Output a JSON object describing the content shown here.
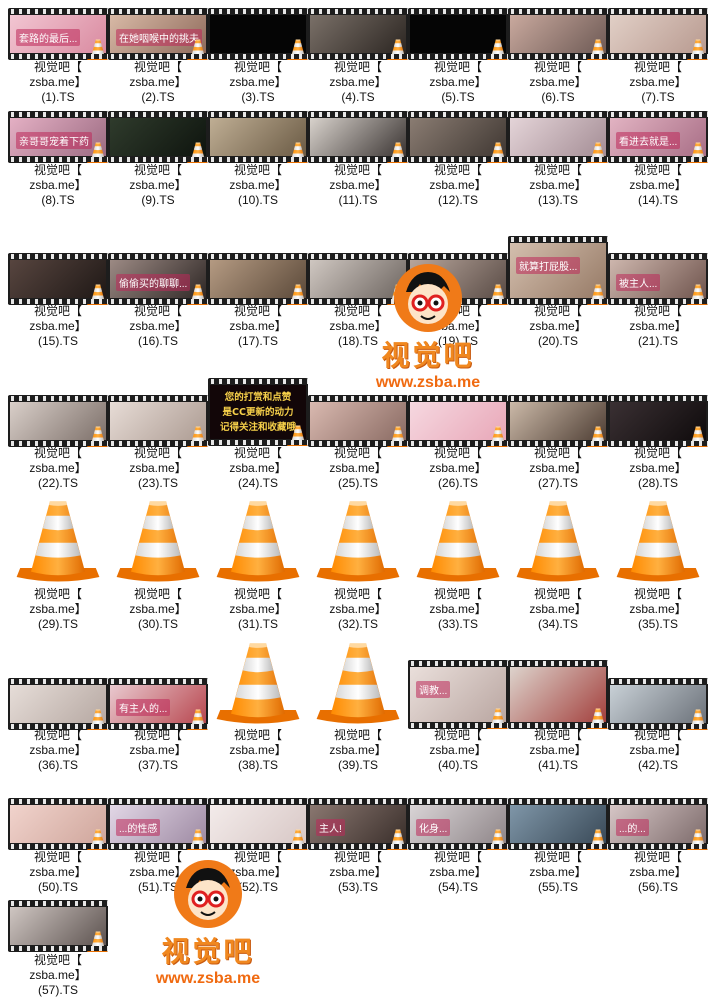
{
  "explorer": {
    "files": [
      {
        "line1": "视觉吧【",
        "line2": "zsba.me】",
        "line3": "(1).TS",
        "thumb": "film",
        "caption": "套路的最后...",
        "colors": [
          "#f2c6d2",
          "#d98aa0"
        ]
      },
      {
        "line1": "视觉吧【",
        "line2": "zsba.me】",
        "line3": "(2).TS",
        "thumb": "film",
        "caption": "在她咽喉中的挑夫",
        "colors": [
          "#d8b9a6",
          "#8f6b5c"
        ]
      },
      {
        "line1": "视觉吧【",
        "line2": "zsba.me】",
        "line3": "(3).TS",
        "thumb": "black",
        "caption": "",
        "colors": [
          "#050505",
          "#050505"
        ]
      },
      {
        "line1": "视觉吧【",
        "line2": "zsba.me】",
        "line3": "(4).TS",
        "thumb": "film",
        "caption": "",
        "colors": [
          "#7a7068",
          "#2c2622"
        ]
      },
      {
        "line1": "视觉吧【",
        "line2": "zsba.me】",
        "line3": "(5).TS",
        "thumb": "black",
        "caption": "",
        "colors": [
          "#050505",
          "#050505"
        ]
      },
      {
        "line1": "视觉吧【",
        "line2": "zsba.me】",
        "line3": "(6).TS",
        "thumb": "film",
        "caption": "",
        "colors": [
          "#c9a99e",
          "#6e5a55"
        ]
      },
      {
        "line1": "视觉吧【",
        "line2": "zsba.me】",
        "line3": "(7).TS",
        "thumb": "film",
        "caption": "",
        "colors": [
          "#e1cfc6",
          "#b89a90"
        ]
      },
      {
        "line1": "视觉吧【",
        "line2": "zsba.me】",
        "line3": "(8).TS",
        "thumb": "film",
        "caption": "亲哥哥宠着下药",
        "colors": [
          "#e4b0c4",
          "#9c6b82"
        ]
      },
      {
        "line1": "视觉吧【",
        "line2": "zsba.me】",
        "line3": "(9).TS",
        "thumb": "film",
        "caption": "",
        "colors": [
          "#2f3b2c",
          "#0e140e"
        ]
      },
      {
        "line1": "视觉吧【",
        "line2": "zsba.me】",
        "line3": "(10).TS",
        "thumb": "film",
        "caption": "",
        "colors": [
          "#bfae94",
          "#6b5b45"
        ]
      },
      {
        "line1": "视觉吧【",
        "line2": "zsba.me】",
        "line3": "(11).TS",
        "thumb": "film",
        "caption": "",
        "colors": [
          "#d8d2cc",
          "#3b3533"
        ]
      },
      {
        "line1": "视觉吧【",
        "line2": "zsba.me】",
        "line3": "(12).TS",
        "thumb": "film",
        "caption": "",
        "colors": [
          "#8a7c72",
          "#403833"
        ]
      },
      {
        "line1": "视觉吧【",
        "line2": "zsba.me】",
        "line3": "(13).TS",
        "thumb": "film",
        "caption": "",
        "colors": [
          "#e4d4d8",
          "#a48d95"
        ]
      },
      {
        "line1": "视觉吧【",
        "line2": "zsba.me】",
        "line3": "(14).TS",
        "thumb": "film",
        "caption": "看进去就是...",
        "colors": [
          "#e2b3c2",
          "#a86e86"
        ]
      },
      {
        "line1": "视觉吧【",
        "line2": "zsba.me】",
        "line3": "(15).TS",
        "thumb": "film",
        "caption": "",
        "colors": [
          "#57453f",
          "#1f1816"
        ]
      },
      {
        "line1": "视觉吧【",
        "line2": "zsba.me】",
        "line3": "(16).TS",
        "thumb": "film",
        "caption": "偷偷买的聊聊...",
        "colors": [
          "#9c8a84",
          "#2f2826"
        ]
      },
      {
        "line1": "视觉吧【",
        "line2": "zsba.me】",
        "line3": "(17).TS",
        "thumb": "film",
        "caption": "",
        "colors": [
          "#b49a82",
          "#5c4a3a"
        ]
      },
      {
        "line1": "视觉吧【",
        "line2": "zsba.me】",
        "line3": "(18).TS",
        "thumb": "film",
        "caption": "",
        "colors": [
          "#cfc7c1",
          "#6d6560"
        ]
      },
      {
        "line1": "视觉吧【",
        "line2": "zsba.me】",
        "line3": "(19).TS",
        "thumb": "film",
        "caption": "",
        "colors": [
          "#b7a59b",
          "#5a4c46"
        ]
      },
      {
        "line1": "视觉吧【",
        "line2": "zsba.me】",
        "line3": "(20).TS",
        "thumb": "film",
        "caption": "就算打屁股...",
        "colors": [
          "#d4bfae",
          "#967a66"
        ]
      },
      {
        "line1": "视觉吧【",
        "line2": "zsba.me】",
        "line3": "(21).TS",
        "thumb": "film",
        "caption": "被主人...",
        "colors": [
          "#cdb6ad",
          "#70554e"
        ]
      },
      {
        "line1": "视觉吧【",
        "line2": "zsba.me】",
        "line3": "(22).TS",
        "thumb": "film",
        "caption": "",
        "colors": [
          "#d9cfc9",
          "#7d706a"
        ]
      },
      {
        "line1": "视觉吧【",
        "line2": "zsba.me】",
        "line3": "(23).TS",
        "thumb": "film",
        "caption": "",
        "colors": [
          "#e7dcd6",
          "#ac9b92"
        ]
      },
      {
        "line1": "视觉吧【",
        "line2": "zsba.me】",
        "line3": "(24).TS",
        "thumb": "text",
        "caption": "",
        "colors": [
          "#120608",
          "#120608"
        ],
        "text_lines": [
          "您的打赏和点赞",
          "是CC更新的动力",
          "记得关注和收藏哦"
        ]
      },
      {
        "line1": "视觉吧【",
        "line2": "zsba.me】",
        "line3": "(25).TS",
        "thumb": "film",
        "caption": "",
        "colors": [
          "#d9b9b0",
          "#8a6b63"
        ]
      },
      {
        "line1": "视觉吧【",
        "line2": "zsba.me】",
        "line3": "(26).TS",
        "thumb": "film",
        "caption": "",
        "colors": [
          "#f6d8e0",
          "#e8a7b8"
        ]
      },
      {
        "line1": "视觉吧【",
        "line2": "zsba.me】",
        "line3": "(27).TS",
        "thumb": "film",
        "caption": "",
        "colors": [
          "#cbb9a8",
          "#4e3e34"
        ]
      },
      {
        "line1": "视觉吧【",
        "line2": "zsba.me】",
        "line3": "(28).TS",
        "thumb": "film",
        "caption": "",
        "colors": [
          "#3a3033",
          "#0f0b0c"
        ]
      },
      {
        "line1": "视觉吧【",
        "line2": "zsba.me】",
        "line3": "(29).TS",
        "thumb": "cone",
        "caption": "",
        "colors": []
      },
      {
        "line1": "视觉吧【",
        "line2": "zsba.me】",
        "line3": "(30).TS",
        "thumb": "cone",
        "caption": "",
        "colors": []
      },
      {
        "line1": "视觉吧【",
        "line2": "zsba.me】",
        "line3": "(31).TS",
        "thumb": "cone",
        "caption": "",
        "colors": []
      },
      {
        "line1": "视觉吧【",
        "line2": "zsba.me】",
        "line3": "(32).TS",
        "thumb": "cone",
        "caption": "",
        "colors": []
      },
      {
        "line1": "视觉吧【",
        "line2": "zsba.me】",
        "line3": "(33).TS",
        "thumb": "cone",
        "caption": "",
        "colors": []
      },
      {
        "line1": "视觉吧【",
        "line2": "zsba.me】",
        "line3": "(34).TS",
        "thumb": "cone",
        "caption": "",
        "colors": []
      },
      {
        "line1": "视觉吧【",
        "line2": "zsba.me】",
        "line3": "(35).TS",
        "thumb": "cone",
        "caption": "",
        "colors": []
      },
      {
        "line1": "视觉吧【",
        "line2": "zsba.me】",
        "line3": "(36).TS",
        "thumb": "film",
        "caption": "",
        "colors": [
          "#e6ddd8",
          "#b6a8a2"
        ]
      },
      {
        "line1": "视觉吧【",
        "line2": "zsba.me】",
        "line3": "(37).TS",
        "thumb": "film",
        "caption": "有主人的...",
        "colors": [
          "#e9c9cf",
          "#b8474f"
        ]
      },
      {
        "line1": "视觉吧【",
        "line2": "zsba.me】",
        "line3": "(38).TS",
        "thumb": "cone",
        "caption": "",
        "colors": []
      },
      {
        "line1": "视觉吧【",
        "line2": "zsba.me】",
        "line3": "(39).TS",
        "thumb": "cone",
        "caption": "",
        "colors": []
      },
      {
        "line1": "视觉吧【",
        "line2": "zsba.me】",
        "line3": "(40).TS",
        "thumb": "film",
        "caption": "调教...",
        "colors": [
          "#eadfdb",
          "#b9a6a1"
        ]
      },
      {
        "line1": "视觉吧【",
        "line2": "zsba.me】",
        "line3": "(41).TS",
        "thumb": "film",
        "caption": "",
        "colors": [
          "#ddd3cc",
          "#a3403d"
        ]
      },
      {
        "line1": "视觉吧【",
        "line2": "zsba.me】",
        "line3": "(42).TS",
        "thumb": "film",
        "caption": "",
        "colors": [
          "#c8d0d6",
          "#6c727a"
        ]
      },
      {
        "line1": "视觉吧【",
        "line2": "zsba.me】",
        "line3": "(50).TS",
        "thumb": "film",
        "caption": "",
        "colors": [
          "#f1d3cc",
          "#cfa69c"
        ]
      },
      {
        "line1": "视觉吧【",
        "line2": "zsba.me】",
        "line3": "(51).TS",
        "thumb": "film",
        "caption": "...的性感",
        "colors": [
          "#e2d7e6",
          "#9e8aa3"
        ]
      },
      {
        "line1": "视觉吧【",
        "line2": "zsba.me】",
        "line3": "(52).TS",
        "thumb": "film",
        "caption": "",
        "colors": [
          "#f3ebea",
          "#d8c8c6"
        ]
      },
      {
        "line1": "视觉吧【",
        "line2": "zsba.me】",
        "line3": "(53).TS",
        "thumb": "film",
        "caption": "主人!",
        "colors": [
          "#8a7770",
          "#3a2f2b"
        ]
      },
      {
        "line1": "视觉吧【",
        "line2": "zsba.me】",
        "line3": "(54).TS",
        "thumb": "film",
        "caption": "化身...",
        "colors": [
          "#d9d4d6",
          "#8f8689"
        ]
      },
      {
        "line1": "视觉吧【",
        "line2": "zsba.me】",
        "line3": "(55).TS",
        "thumb": "film",
        "caption": "",
        "colors": [
          "#7f96a8",
          "#3a4a58"
        ]
      },
      {
        "line1": "视觉吧【",
        "line2": "zsba.me】",
        "line3": "(56).TS",
        "thumb": "film",
        "caption": "...的...",
        "colors": [
          "#d6c6c6",
          "#7d6b6b"
        ]
      },
      {
        "line1": "视觉吧【",
        "line2": "zsba.me】",
        "line3": "(57).TS",
        "thumb": "film",
        "caption": "",
        "colors": [
          "#cfc6c2",
          "#5d5350"
        ]
      }
    ]
  },
  "watermarks": [
    {
      "brand": "视觉吧",
      "url": "www.zsba.me"
    },
    {
      "brand": "视觉吧",
      "url": "www.zsba.me"
    }
  ]
}
